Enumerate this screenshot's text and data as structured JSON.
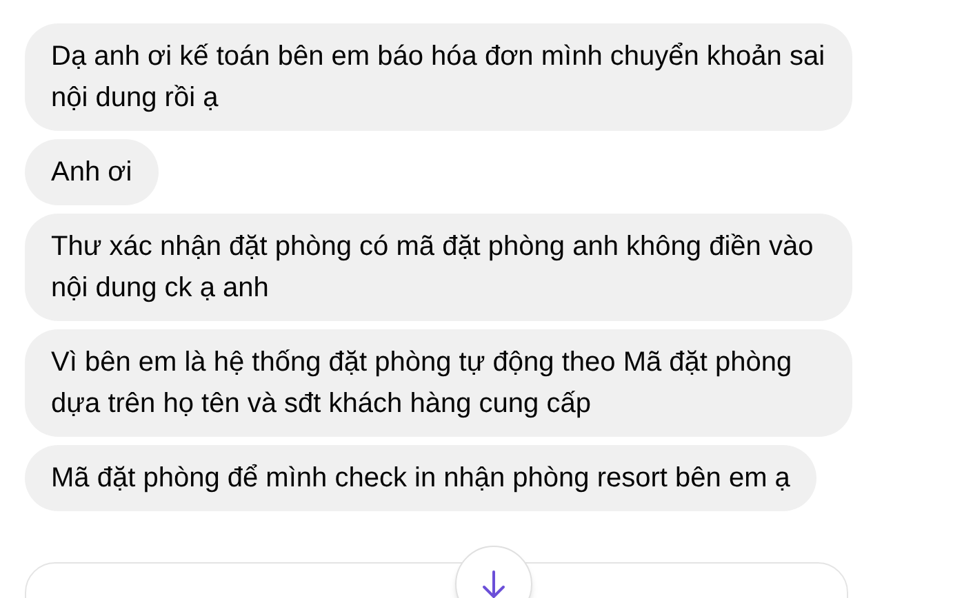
{
  "messages": [
    {
      "text": "Dạ anh ơi kế toán bên em báo hóa đơn mình chuyển khoản sai nội dung rồi ạ"
    },
    {
      "text": "Anh ơi"
    },
    {
      "text": "Thư xác nhận đặt phòng có mã đặt phòng anh không điền vào nội dung ck ạ anh"
    },
    {
      "text": "Vì bên em là hệ thống đặt phòng tự động theo Mã đặt phòng dựa trên họ tên và sđt khách hàng cung cấp"
    },
    {
      "text": "Mã đặt phòng để mình check in nhận phòng resort bên em ạ"
    }
  ]
}
